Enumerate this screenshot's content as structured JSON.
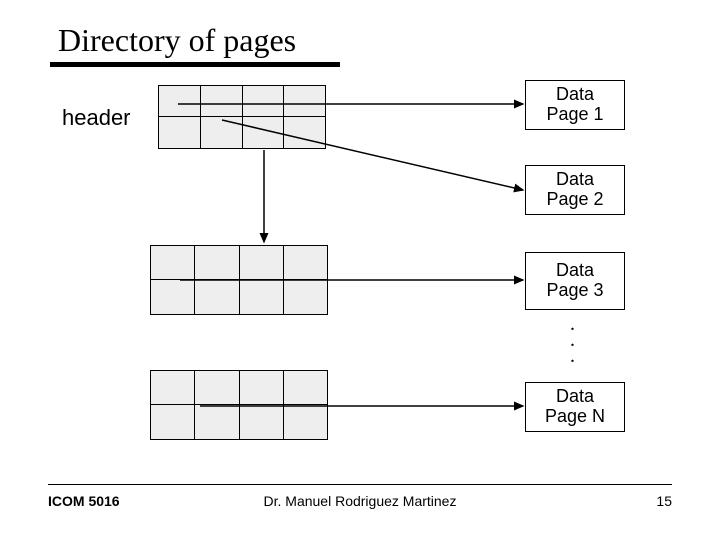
{
  "title": "Directory of pages",
  "header_label": "header",
  "data_pages": {
    "p1": "Data\nPage 1",
    "p2": "Data\nPage 2",
    "p3": "Data\nPage 3",
    "pN": "Data\nPage N"
  },
  "footer": {
    "course": "ICOM 5016",
    "author": "Dr. Manuel Rodriguez Martinez",
    "page_number": "15"
  }
}
